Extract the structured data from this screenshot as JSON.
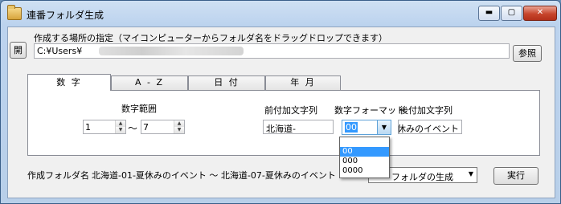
{
  "window": {
    "title": "連番フォルダ生成",
    "minimize_icon": "minimize-icon",
    "maximize_icon": "maximize-icon",
    "close_icon": "close-icon",
    "close_glyph": "✕",
    "app_icon": "folder-icon"
  },
  "location": {
    "instruction": "作成する場所の指定（マイコンピューターからフォルダ名をドラッグドロップできます）",
    "open_label": "開",
    "path_value": "C:¥Users¥",
    "browse_label": "参照"
  },
  "tabs": [
    {
      "label": "数 字",
      "active": true
    },
    {
      "label": "A - Z",
      "active": false
    },
    {
      "label": "日 付",
      "active": false
    },
    {
      "label": "年 月",
      "active": false
    }
  ],
  "number_tab": {
    "range_label": "数字範囲",
    "range_from": "1",
    "range_to": "7",
    "tilde": "～",
    "prefix_label": "前付加文字列",
    "prefix_value": "北海道-",
    "format_label": "数字フォーマット",
    "format_selected": "00",
    "format_options": [
      "",
      "00",
      "000",
      "0000"
    ],
    "suffix_label": "後付加文字列",
    "suffix_value": "-夏休みのイベント"
  },
  "footer": {
    "preview_label": "作成フォルダ名",
    "preview_value": "北海道-01-夏休みのイベント ～ 北海道-07-夏休みのイベント",
    "action_value": "フォルダの生成",
    "execute_label": "実行"
  }
}
